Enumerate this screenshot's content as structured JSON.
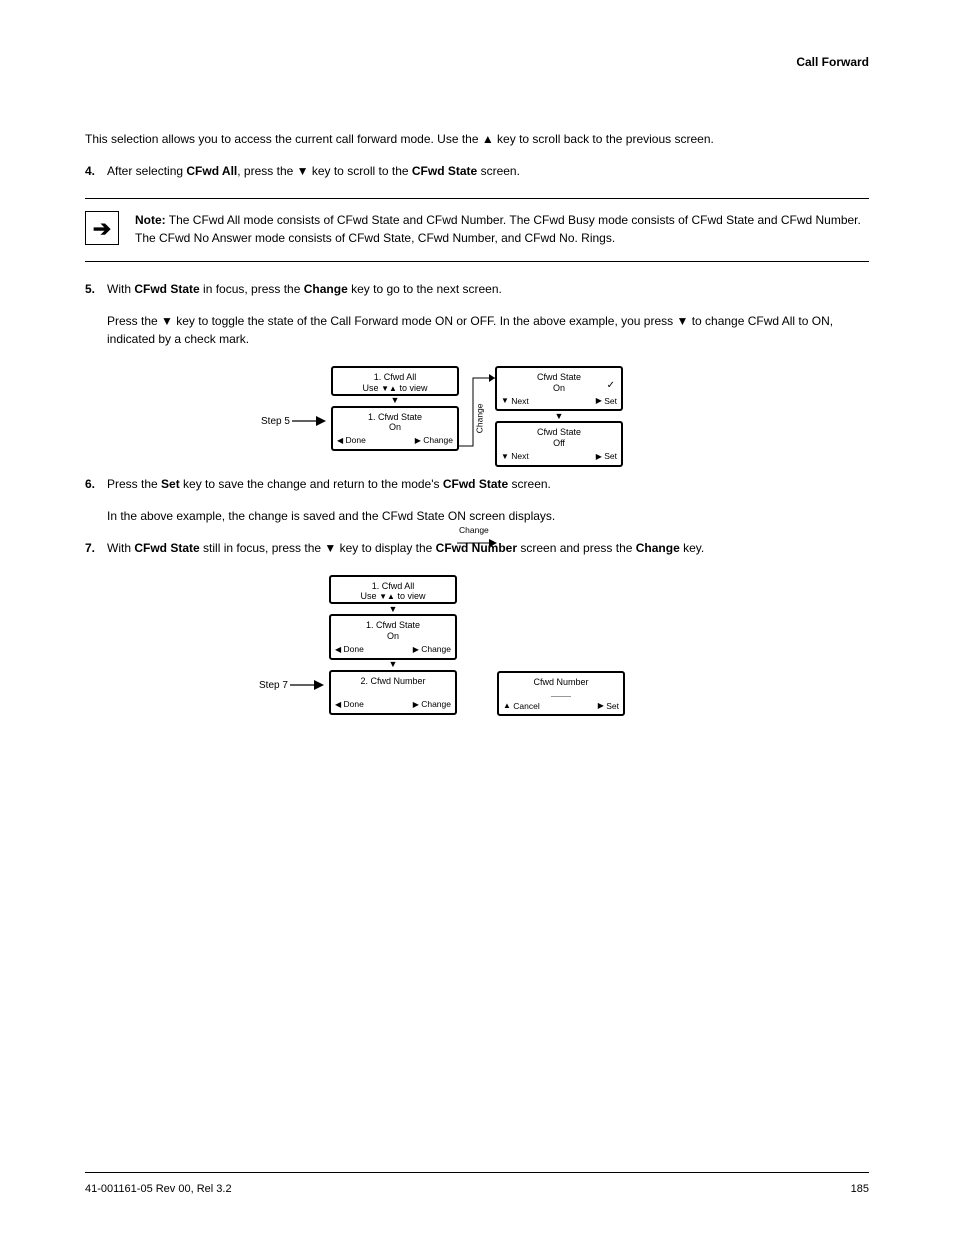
{
  "header": {
    "title": "Call Forward"
  },
  "p1": "This selection allows you to access the current call forward mode. Use the ▲ key to scroll back to the previous screen.",
  "step4": {
    "num": "4.",
    "text_a": "After selecting ",
    "bold": "CFwd All",
    "text_b": ", press the ▼ key to scroll to the ",
    "bold2": "CFwd State",
    "text_c": " screen."
  },
  "note": {
    "label": "Note:",
    "text": "The CFwd All mode consists of CFwd State and CFwd Number. The CFwd Busy mode consists of CFwd State and CFwd Number. The CFwd No Answer mode consists of CFwd State, CFwd Number, and CFwd No. Rings."
  },
  "step5": {
    "num": "5.",
    "before_bold": "With ",
    "bold1": "CFwd State",
    "mid": " in focus, press the ",
    "bold2": "Change",
    "after": " key to go to the next screen."
  },
  "step5b": "Press the ▼ key to toggle the state of the Call Forward mode ON or OFF. In the above example, you press ▼ to change CFwd All to ON, indicated by a check mark.",
  "step6": {
    "num": "6.",
    "seg": [
      "Press the ",
      "Set",
      " key to save the change and return to the mode's ",
      "CFwd State",
      " screen."
    ]
  },
  "step6b": "In the above example, the change is saved and the CFwd State ON screen displays.",
  "step7": {
    "num": "7.",
    "seg": [
      "With ",
      "CFwd State",
      " still in focus, press the ▼ key to display the ",
      "CFwd Number",
      " screen and press the ",
      "Change",
      " key."
    ]
  },
  "diag1": {
    "col1": {
      "a": {
        "l1": "1. Cfwd All",
        "l2_use": "Use",
        "l2_view": "to view"
      },
      "b": {
        "l1": "1. Cfwd State",
        "l2": "On",
        "left": "Done",
        "right": "Change"
      }
    },
    "connector1": "Change",
    "col2": {
      "a": {
        "l1": "Cfwd State",
        "l2": "On",
        "left": "Next",
        "right": "Set"
      },
      "b": {
        "l1": "Cfwd State",
        "l2": "Off",
        "left": "Next",
        "right": "Set"
      }
    },
    "stepLabel": "Step 5"
  },
  "diag2": {
    "col1": {
      "a": {
        "l1": "1. Cfwd All",
        "l2_use": "Use",
        "l2_view": "to view"
      },
      "b": {
        "l1": "1. Cfwd State",
        "l2": "On",
        "left": "Done",
        "right": "Change"
      },
      "c": {
        "l1": "2. Cfwd Number",
        "left": "Done",
        "right": "Change"
      }
    },
    "connector": "Change",
    "col2": {
      "a": {
        "l1": "Cfwd Number",
        "left": "Cancel",
        "right": "Set"
      }
    },
    "stepLabel": "Step 7"
  },
  "footer": {
    "left": "41-001161-05 Rev 00, Rel 3.2",
    "right": "185"
  }
}
